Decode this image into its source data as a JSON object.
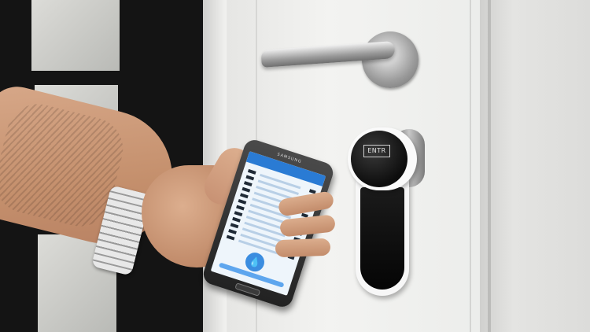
{
  "scene": {
    "lock_logo": "ENTR",
    "phone_brand": "SAMSUNG",
    "screen_rows": 12,
    "drop_glyph": "💧"
  },
  "colors": {
    "lock_face": "#0d0d0d",
    "lock_body": "#f7f7f7",
    "app_accent": "#2a7bd4",
    "door": "#ecedeb"
  }
}
